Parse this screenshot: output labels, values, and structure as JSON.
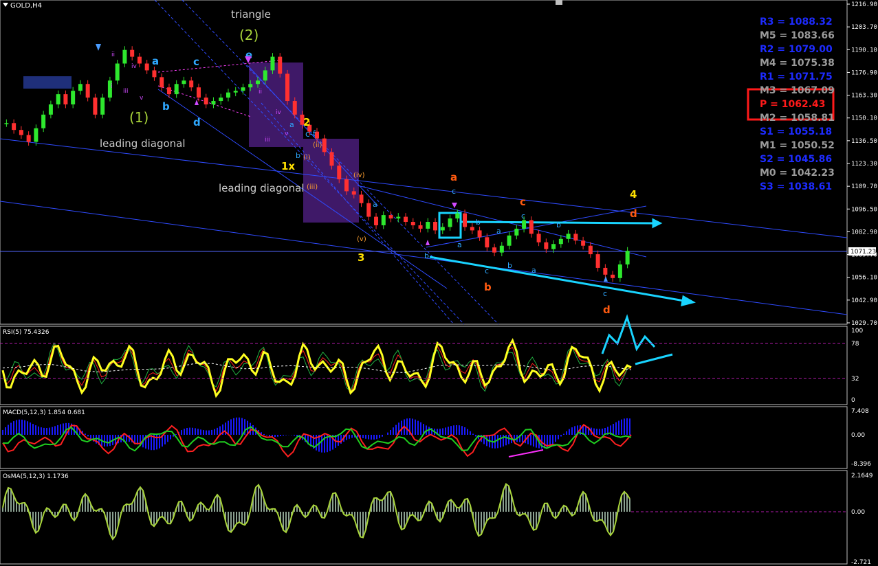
{
  "window": {
    "symbol_label": "GOLD,H4",
    "menu_icon": "triangle-down-icon"
  },
  "panels": {
    "rsi_label": "RSI(5) 75.4326",
    "macd_label": "MACD(5,12,3) 1.854 0.681",
    "osma_label": "OsMA(5,12,3) 1.1736"
  },
  "price_axis": {
    "ticks": [
      "1216.90",
      "1203.70",
      "1190.10",
      "1176.90",
      "1163.30",
      "1150.10",
      "1136.50",
      "1123.30",
      "1109.70",
      "1096.50",
      "1082.90",
      "1069.70",
      "1056.10",
      "1042.90",
      "1029.70"
    ],
    "current_price": "1071.23",
    "current_value": 1071.23
  },
  "rsi_axis": {
    "ticks": [
      "100",
      "78",
      "32",
      "0"
    ]
  },
  "macd_axis": {
    "ticks": [
      "7.408",
      "0.00",
      "-8.396"
    ]
  },
  "osma_axis": {
    "ticks": [
      "2.1649",
      "0.00",
      "-2.721"
    ]
  },
  "pivots": [
    {
      "label": "R3 = 1088.32",
      "color": "#1d2bff"
    },
    {
      "label": "M5 = 1083.66",
      "color": "#9a9a9a"
    },
    {
      "label": "R2 = 1079.00",
      "color": "#1d2bff"
    },
    {
      "label": "M4 = 1075.38",
      "color": "#9a9a9a"
    },
    {
      "label": "R1 = 1071.75",
      "color": "#1d2bff"
    },
    {
      "label": "M3 = 1067.09",
      "color": "#9a9a9a"
    },
    {
      "label": "P   = 1062.43",
      "color": "#ff1a1a"
    },
    {
      "label": "M2 = 1058.81",
      "color": "#9a9a9a"
    },
    {
      "label": "S1 = 1055.18",
      "color": "#1d2bff"
    },
    {
      "label": "M1 = 1050.52",
      "color": "#9a9a9a"
    },
    {
      "label": "S2 = 1045.86",
      "color": "#1d2bff"
    },
    {
      "label": "M0 = 1042.23",
      "color": "#9a9a9a"
    },
    {
      "label": "S3 = 1038.61",
      "color": "#1d2bff"
    }
  ],
  "chart_data": {
    "type": "line",
    "title": "GOLD,H4",
    "ylim": [
      1029.7,
      1216.9
    ],
    "grid": false,
    "series": [
      {
        "values": [
          1147,
          1143,
          1140,
          1136,
          1144,
          1152,
          1158,
          1164,
          1158,
          1166,
          1170,
          1162,
          1152,
          1162,
          1172,
          1182,
          1190,
          1186,
          1182,
          1178,
          1174,
          1168,
          1164,
          1170,
          1172,
          1168,
          1162,
          1158,
          1160,
          1162,
          1165,
          1166,
          1168,
          1170,
          1172,
          1178,
          1186,
          1176,
          1160,
          1152,
          1146,
          1142,
          1138,
          1130,
          1122,
          1114,
          1107,
          1105,
          1100,
          1092,
          1087,
          1093,
          1091,
          1092,
          1089,
          1087,
          1085,
          1089,
          1084,
          1086,
          1091,
          1094,
          1086,
          1084,
          1080,
          1074,
          1071,
          1075,
          1081,
          1085,
          1090,
          1082,
          1077,
          1073,
          1076,
          1079,
          1082,
          1078,
          1075,
          1070,
          1062,
          1058,
          1056,
          1064,
          1072
        ]
      }
    ],
    "annotations": [
      "triangle",
      "(2)",
      "(1)",
      "leading diagonal",
      "leading diagonal",
      "1x",
      "2",
      "3",
      "4",
      "a",
      "b",
      "c",
      "d",
      "e",
      "c-f",
      "i",
      "ii",
      "iii",
      "iv",
      "v",
      "(i)",
      "(ii)",
      "(iii)",
      "(iv)",
      "(v)"
    ]
  },
  "labels": {
    "triangle": "triangle",
    "wave2": "(2)",
    "wave1": "(1)",
    "leading1": "leading diagonal",
    "leading2": "leading diagonal",
    "w1x": "1x",
    "w2": "2",
    "w3": "3",
    "w4": "4",
    "cf": "c-f",
    "a": "a",
    "b": "b",
    "c": "c",
    "d": "d",
    "e": "e",
    "i": "i",
    "ii": "ii",
    "iii": "iii",
    "iv": "iv",
    "v": "v",
    "pi": "(i)",
    "pii": "(ii)",
    "piii": "(iii)",
    "piv": "(iv)",
    "pv": "(v)"
  }
}
